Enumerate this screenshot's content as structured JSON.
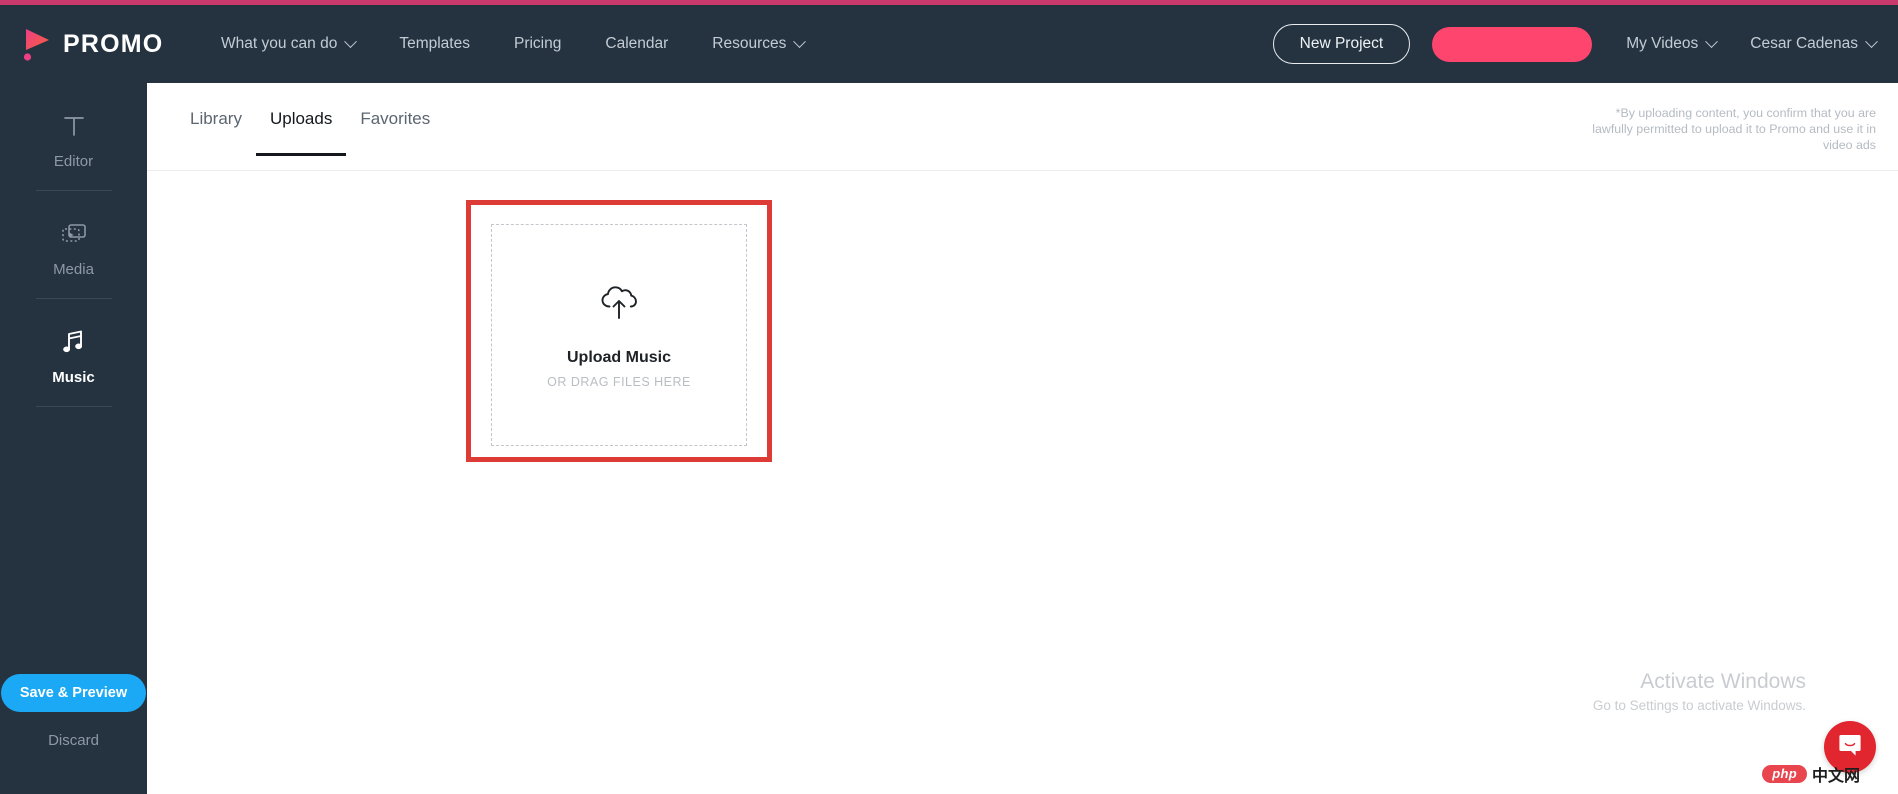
{
  "brand": {
    "name": "PROMO",
    "accent_color": "#c9396b",
    "logo_gradient_from": "#f0447a",
    "logo_gradient_to": "#f4563f"
  },
  "header": {
    "background": "#253340",
    "nav": [
      {
        "label": "What you can do",
        "has_caret": true
      },
      {
        "label": "Templates",
        "has_caret": false
      },
      {
        "label": "Pricing",
        "has_caret": false
      },
      {
        "label": "Calendar",
        "has_caret": false
      },
      {
        "label": "Resources",
        "has_caret": true
      }
    ],
    "new_project_label": "New Project",
    "cta_label": "",
    "cta_color": "#fd456d",
    "my_videos_label": "My Videos",
    "account_label": "Cesar Cadenas"
  },
  "sidebar": {
    "background": "#253340",
    "items": [
      {
        "label": "Editor",
        "icon": "text-tool-icon",
        "active": false
      },
      {
        "label": "Media",
        "icon": "media-library-icon",
        "active": false
      },
      {
        "label": "Music",
        "icon": "music-note-icon",
        "active": true
      }
    ],
    "save_preview_label": "Save & Preview",
    "save_preview_color": "#1ba9f5",
    "discard_label": "Discard"
  },
  "content": {
    "tabs": [
      {
        "label": "Library",
        "active": false
      },
      {
        "label": "Uploads",
        "active": true
      },
      {
        "label": "Favorites",
        "active": false
      }
    ],
    "disclaimer": "*By uploading content, you confirm that you are lawfully permitted to upload it to Promo and use it in video ads",
    "upload": {
      "title": "Upload Music",
      "subtitle": "OR DRAG FILES HERE",
      "icon": "cloud-upload-icon",
      "highlight_color": "#dd3b35"
    }
  },
  "overlays": {
    "windows_watermark_title": "Activate Windows",
    "windows_watermark_subtitle": "Go to Settings to activate Windows.",
    "chat_color": "#e2262f",
    "php_pill_text": "php",
    "php_cn_text": "中文网"
  }
}
